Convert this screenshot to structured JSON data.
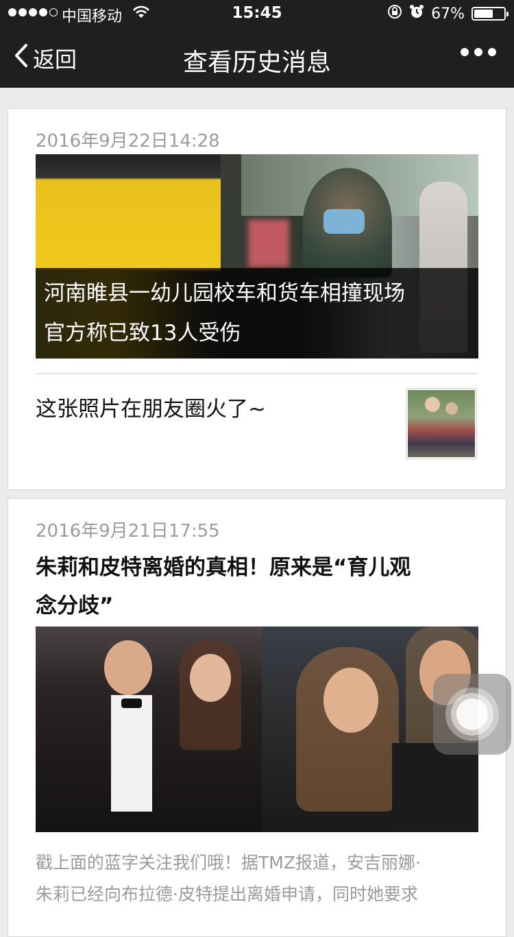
{
  "status_bar": {
    "carrier": "中国移动",
    "time": "15:45",
    "battery": "67%",
    "battery_level": 0.67,
    "signal_bars_filled": 4,
    "signal_bars_total": 5
  },
  "nav": {
    "back_label": "返回",
    "title": "查看历史消息"
  },
  "messages": [
    {
      "date": "2016年9月22日14:28",
      "hero_caption_line1": "河南睢县一幼儿园校车和货车相撞现场",
      "hero_caption_line2": "官方称已致13人受伤",
      "sub_article_title": "这张照片在朋友圈火了~"
    },
    {
      "date": "2016年9月21日17:55",
      "headline_line1": "朱莉和皮特离婚的真相！原来是“育儿观",
      "headline_line2": "念分歧”",
      "summary_line1": "戳上面的蓝字关注我们哦！据TMZ报道，安吉丽娜·",
      "summary_line2": "朱莉已经向布拉德·皮特提出离婚申请，同时她要求"
    }
  ],
  "colors": {
    "nav_bg": "#1f1f22",
    "page_bg": "#ebebeb",
    "date_text": "#9b9b9b",
    "summary_text": "#9a9a9a"
  }
}
